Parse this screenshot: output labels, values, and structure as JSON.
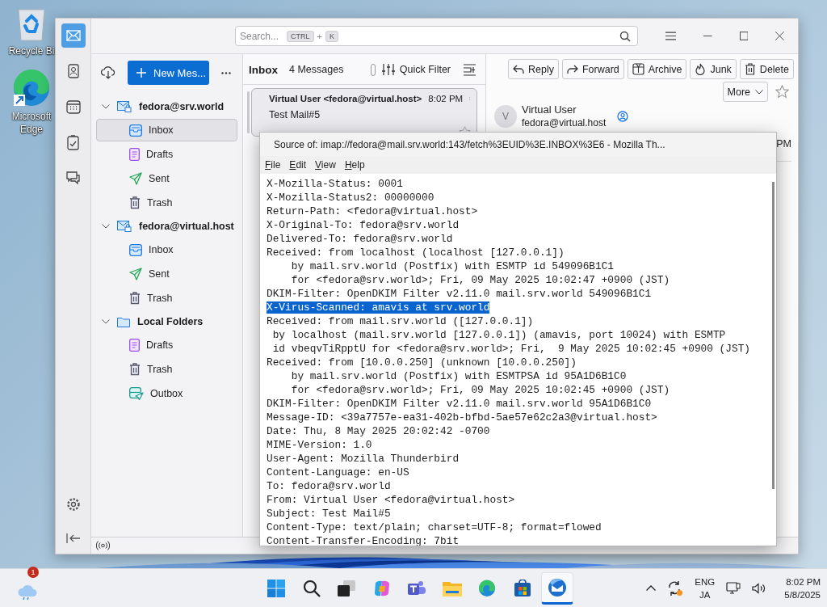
{
  "desktop_icons": [
    {
      "label": "Recycle Bi",
      "kind": "recycle"
    },
    {
      "label": "Microsoft Edge",
      "kind": "edge"
    }
  ],
  "thunderbird": {
    "spaces": [
      {
        "kind": "mail",
        "selected": true
      },
      {
        "kind": "contacts",
        "selected": false
      },
      {
        "kind": "calendar",
        "selected": false
      },
      {
        "kind": "tasks",
        "selected": false
      },
      {
        "kind": "chat",
        "selected": false
      }
    ],
    "search": {
      "placeholder": "Search...",
      "keys": [
        "CTRL",
        "K"
      ],
      "separator": "+"
    },
    "new_message": "New Mes...",
    "accounts": [
      {
        "name": "fedora@srv.world",
        "kind": "imap",
        "expanded": true,
        "folders": [
          {
            "name": "Inbox",
            "kind": "inbox",
            "selected": true
          },
          {
            "name": "Drafts",
            "kind": "drafts",
            "selected": false
          },
          {
            "name": "Sent",
            "kind": "sent",
            "selected": false
          },
          {
            "name": "Trash",
            "kind": "trash",
            "selected": false
          }
        ]
      },
      {
        "name": "fedora@virtual.host",
        "kind": "imap",
        "expanded": true,
        "folders": [
          {
            "name": "Inbox",
            "kind": "inbox",
            "selected": false
          },
          {
            "name": "Sent",
            "kind": "sent",
            "selected": false
          },
          {
            "name": "Trash",
            "kind": "trash",
            "selected": false
          }
        ]
      },
      {
        "name": "Local Folders",
        "kind": "local",
        "expanded": true,
        "folders": [
          {
            "name": "Drafts",
            "kind": "drafts",
            "selected": false
          },
          {
            "name": "Trash",
            "kind": "trash",
            "selected": false
          },
          {
            "name": "Outbox",
            "kind": "outbox",
            "selected": false
          }
        ]
      }
    ],
    "message_list": {
      "folder": "Inbox",
      "count": "4 Messages",
      "quick_filter": "Quick Filter",
      "toggle_on": false,
      "messages": [
        {
          "from": "Virtual User <fedora@virtual.host>",
          "time": "8:02 PM",
          "subject": "Test Mail#5",
          "selected": true
        }
      ]
    },
    "message_header": {
      "buttons": [
        {
          "label": "Reply",
          "kind": "reply"
        },
        {
          "label": "Forward",
          "kind": "forward"
        },
        {
          "label": "Archive",
          "kind": "archive"
        },
        {
          "label": "Junk",
          "kind": "junk"
        },
        {
          "label": "Delete",
          "kind": "delete"
        }
      ],
      "more": "More",
      "avatar": "V",
      "sender_name": "Virtual User",
      "sender_email": "fedora@virtual.host",
      "date_fragment": "PM"
    }
  },
  "source_window": {
    "title": "Source of: imap://fedora@mail.srv.world:143/fetch%3EUID%3E.INBOX%3E6 - Mozilla Th...",
    "menus": [
      "File",
      "Edit",
      "View",
      "Help"
    ],
    "lines": [
      {
        "text": "X-Mozilla-Status: 0001",
        "selected": false
      },
      {
        "text": "X-Mozilla-Status2: 00000000",
        "selected": false
      },
      {
        "text": "Return-Path: <fedora@virtual.host>",
        "selected": false
      },
      {
        "text": "X-Original-To: fedora@srv.world",
        "selected": false
      },
      {
        "text": "Delivered-To: fedora@srv.world",
        "selected": false
      },
      {
        "text": "Received: from localhost (localhost [127.0.0.1])",
        "selected": false
      },
      {
        "text": "    by mail.srv.world (Postfix) with ESMTP id 549096B1C1",
        "selected": false
      },
      {
        "text": "    for <fedora@srv.world>; Fri, 09 May 2025 10:02:47 +0900 (JST)",
        "selected": false
      },
      {
        "text": "DKIM-Filter: OpenDKIM Filter v2.11.0 mail.srv.world 549096B1C1",
        "selected": false
      },
      {
        "text": "X-Virus-Scanned: amavis at srv.world",
        "selected": true
      },
      {
        "text": "Received: from mail.srv.world ([127.0.0.1])",
        "selected": false
      },
      {
        "text": " by localhost (mail.srv.world [127.0.0.1]) (amavis, port 10024) with ESMTP",
        "selected": false
      },
      {
        "text": " id vbeqvTiRpptU for <fedora@srv.world>; Fri,  9 May 2025 10:02:45 +0900 (JST)",
        "selected": false
      },
      {
        "text": "Received: from [10.0.0.250] (unknown [10.0.0.250])",
        "selected": false
      },
      {
        "text": "    by mail.srv.world (Postfix) with ESMTPSA id 95A1D6B1C0",
        "selected": false
      },
      {
        "text": "    for <fedora@srv.world>; Fri, 09 May 2025 10:02:45 +0900 (JST)",
        "selected": false
      },
      {
        "text": "DKIM-Filter: OpenDKIM Filter v2.11.0 mail.srv.world 95A1D6B1C0",
        "selected": false
      },
      {
        "text": "Message-ID: <39a7757e-ea31-402b-bfbd-5ae57e62c2a3@virtual.host>",
        "selected": false
      },
      {
        "text": "Date: Thu, 8 May 2025 20:02:42 -0700",
        "selected": false
      },
      {
        "text": "MIME-Version: 1.0",
        "selected": false
      },
      {
        "text": "User-Agent: Mozilla Thunderbird",
        "selected": false
      },
      {
        "text": "Content-Language: en-US",
        "selected": false
      },
      {
        "text": "To: fedora@srv.world",
        "selected": false
      },
      {
        "text": "From: Virtual User <fedora@virtual.host>",
        "selected": false
      },
      {
        "text": "Subject: Test Mail#5",
        "selected": false
      },
      {
        "text": "Content-Type: text/plain; charset=UTF-8; format=flowed",
        "selected": false
      },
      {
        "text": "Content-Transfer-Encoding: 7bit",
        "selected": false
      }
    ]
  },
  "taskbar": {
    "weather_badge": "1",
    "apps": [
      {
        "kind": "start",
        "active": false
      },
      {
        "kind": "search",
        "active": false
      },
      {
        "kind": "taskview",
        "active": false
      },
      {
        "kind": "copilot",
        "active": false
      },
      {
        "kind": "teams",
        "active": false
      },
      {
        "kind": "explorer",
        "active": false
      },
      {
        "kind": "edge",
        "active": false
      },
      {
        "kind": "store",
        "active": false
      },
      {
        "kind": "thunderbird",
        "active": true
      }
    ],
    "language": "ENG",
    "input": "JA",
    "time": "8:02 PM",
    "date": "5/8/2025"
  }
}
